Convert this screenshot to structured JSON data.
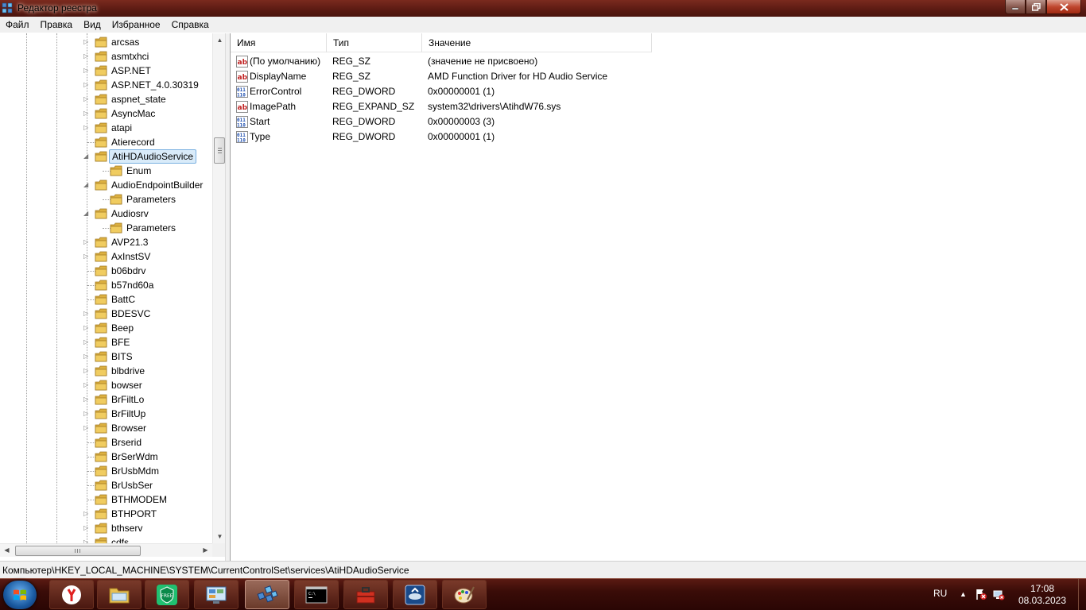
{
  "window": {
    "title": "Редактор реестра",
    "controls": [
      "minimize",
      "maximize",
      "close"
    ]
  },
  "menu": [
    "Файл",
    "Правка",
    "Вид",
    "Избранное",
    "Справка"
  ],
  "tree": {
    "items": [
      {
        "label": "arcsas",
        "level": 0,
        "expander": "collapsed"
      },
      {
        "label": "asmtxhci",
        "level": 0,
        "expander": "collapsed"
      },
      {
        "label": "ASP.NET",
        "level": 0,
        "expander": "collapsed"
      },
      {
        "label": "ASP.NET_4.0.30319",
        "level": 0,
        "expander": "collapsed"
      },
      {
        "label": "aspnet_state",
        "level": 0,
        "expander": "collapsed"
      },
      {
        "label": "AsyncMac",
        "level": 0,
        "expander": "collapsed"
      },
      {
        "label": "atapi",
        "level": 0,
        "expander": "collapsed"
      },
      {
        "label": "Atierecord",
        "level": 0,
        "expander": "none"
      },
      {
        "label": "AtiHDAudioService",
        "level": 0,
        "expander": "expanded",
        "selected": true
      },
      {
        "label": "Enum",
        "level": 1,
        "expander": "none"
      },
      {
        "label": "AudioEndpointBuilder",
        "level": 0,
        "expander": "expanded"
      },
      {
        "label": "Parameters",
        "level": 1,
        "expander": "none"
      },
      {
        "label": "Audiosrv",
        "level": 0,
        "expander": "expanded"
      },
      {
        "label": "Parameters",
        "level": 1,
        "expander": "none"
      },
      {
        "label": "AVP21.3",
        "level": 0,
        "expander": "collapsed"
      },
      {
        "label": "AxInstSV",
        "level": 0,
        "expander": "collapsed"
      },
      {
        "label": "b06bdrv",
        "level": 0,
        "expander": "none"
      },
      {
        "label": "b57nd60a",
        "level": 0,
        "expander": "none"
      },
      {
        "label": "BattC",
        "level": 0,
        "expander": "none"
      },
      {
        "label": "BDESVC",
        "level": 0,
        "expander": "collapsed"
      },
      {
        "label": "Beep",
        "level": 0,
        "expander": "collapsed"
      },
      {
        "label": "BFE",
        "level": 0,
        "expander": "collapsed"
      },
      {
        "label": "BITS",
        "level": 0,
        "expander": "collapsed"
      },
      {
        "label": "blbdrive",
        "level": 0,
        "expander": "collapsed"
      },
      {
        "label": "bowser",
        "level": 0,
        "expander": "collapsed"
      },
      {
        "label": "BrFiltLo",
        "level": 0,
        "expander": "collapsed"
      },
      {
        "label": "BrFiltUp",
        "level": 0,
        "expander": "collapsed"
      },
      {
        "label": "Browser",
        "level": 0,
        "expander": "collapsed"
      },
      {
        "label": "Brserid",
        "level": 0,
        "expander": "none"
      },
      {
        "label": "BrSerWdm",
        "level": 0,
        "expander": "none"
      },
      {
        "label": "BrUsbMdm",
        "level": 0,
        "expander": "none"
      },
      {
        "label": "BrUsbSer",
        "level": 0,
        "expander": "none"
      },
      {
        "label": "BTHMODEM",
        "level": 0,
        "expander": "none"
      },
      {
        "label": "BTHPORT",
        "level": 0,
        "expander": "collapsed"
      },
      {
        "label": "bthserv",
        "level": 0,
        "expander": "collapsed"
      },
      {
        "label": "cdfs",
        "level": 0,
        "expander": "collapsed"
      }
    ]
  },
  "values": {
    "headers": {
      "name": "Имя",
      "type": "Тип",
      "data": "Значение"
    },
    "rows": [
      {
        "icon": "string-value-icon",
        "name": "(По умолчанию)",
        "type": "REG_SZ",
        "data": "(значение не присвоено)"
      },
      {
        "icon": "string-value-icon",
        "name": "DisplayName",
        "type": "REG_SZ",
        "data": "AMD Function Driver for HD Audio Service"
      },
      {
        "icon": "binary-value-icon",
        "name": "ErrorControl",
        "type": "REG_DWORD",
        "data": "0x00000001 (1)"
      },
      {
        "icon": "string-value-icon",
        "name": "ImagePath",
        "type": "REG_EXPAND_SZ",
        "data": "system32\\drivers\\AtihdW76.sys"
      },
      {
        "icon": "binary-value-icon",
        "name": "Start",
        "type": "REG_DWORD",
        "data": "0x00000003 (3)"
      },
      {
        "icon": "binary-value-icon",
        "name": "Type",
        "type": "REG_DWORD",
        "data": "0x00000001 (1)"
      }
    ]
  },
  "statusbar": {
    "path": "Компьютер\\HKEY_LOCAL_MACHINE\\SYSTEM\\CurrentControlSet\\services\\AtiHDAudioService"
  },
  "taskbar": {
    "apps": [
      {
        "name": "yandex-browser-icon",
        "active": false
      },
      {
        "name": "file-explorer-icon",
        "active": false
      },
      {
        "name": "vpn-free-icon",
        "active": false
      },
      {
        "name": "control-panel-icon",
        "active": false
      },
      {
        "name": "registry-editor-icon",
        "active": true
      },
      {
        "name": "command-prompt-icon",
        "active": false
      },
      {
        "name": "toolbox-icon",
        "active": false
      },
      {
        "name": "disk-utility-icon",
        "active": false
      },
      {
        "name": "paint-icon",
        "active": false
      }
    ],
    "tray": {
      "language": "RU",
      "time": "17:08",
      "date": "08.03.2023"
    }
  },
  "colors": {
    "taskbar": "#3a0c08",
    "selection": "#d9ebf9",
    "folder": "#e8c050"
  }
}
